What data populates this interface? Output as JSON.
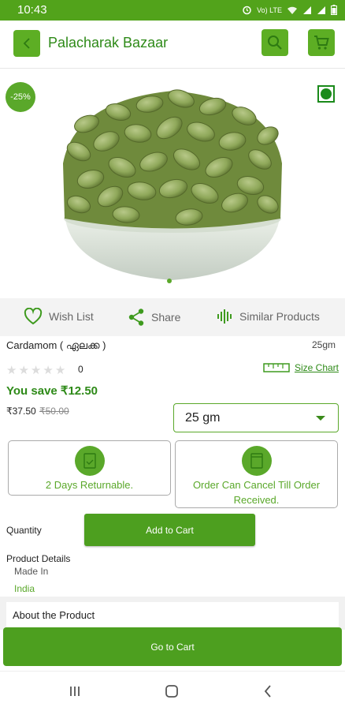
{
  "status": {
    "time": "10:43",
    "net_label": "Vo) LTE"
  },
  "header": {
    "title": "Palacharak Bazaar"
  },
  "product": {
    "discount_badge": "-25%",
    "name": "Cardamom ( ഏലക്ക )",
    "weight": "25gm",
    "rating_count": "0",
    "rating_value": 0,
    "rating_max": 5,
    "you_save": "You save ₹12.50",
    "price": "₹37.50",
    "mrp": "₹50.00",
    "selected_size": "25 gm"
  },
  "actions": {
    "wishlist": "Wish List",
    "share": "Share",
    "similar": "Similar Products"
  },
  "size_chart_label": "Size Chart",
  "policies": {
    "returnable": "2 Days Returnable.",
    "cancel": "Order Can Cancel Till Order Received."
  },
  "quantity_label": "Quantity",
  "add_to_cart": "Add to Cart",
  "details": {
    "heading": "Product Details",
    "made_in_label": "Made In",
    "made_in_value": "India"
  },
  "about_label": "About the Product",
  "go_to_cart": "Go to Cart",
  "colors": {
    "brand_green": "#52a31b",
    "button_green": "#4d9f1f",
    "veg_mark": "#1a8a1a"
  },
  "icons": [
    "back-icon",
    "search-icon",
    "cart-icon",
    "heart-icon",
    "share-icon",
    "similar-icon",
    "ruler-icon",
    "return-icon",
    "cancel-icon"
  ]
}
